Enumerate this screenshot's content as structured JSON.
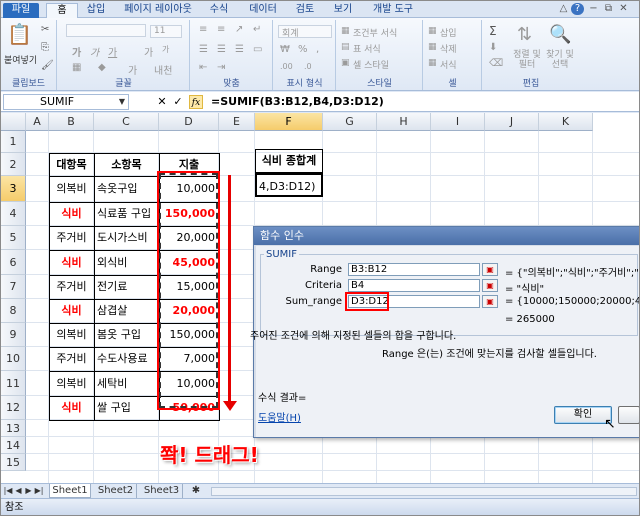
{
  "tabs": {
    "file": "파일",
    "home": "홈",
    "insert": "삽입",
    "page_layout": "페이지 레이아웃",
    "formulas": "수식",
    "data": "데이터",
    "review": "검토",
    "view": "보기",
    "developer": "개발 도구"
  },
  "ribbon": {
    "paste": "붙여넣기",
    "font_size": "11",
    "number_format": "회계",
    "cond_format": "조건부 서식",
    "table_format": "표 서식",
    "cell_style": "셀 스타일",
    "insert": "삽입",
    "delete": "삭제",
    "format": "서식",
    "sort_filter": "정렬 및 필터",
    "find_select": "찾기 및 선택",
    "groups": {
      "clipboard": "클립보드",
      "font": "글꼴",
      "alignment": "맞춤",
      "number": "표시 형식",
      "styles": "스타일",
      "cells": "셀",
      "editing": "편집"
    }
  },
  "formula_bar": {
    "name_box": "SUMIF",
    "formula": "=SUMIF(B3:B12,B4,D3:D12)",
    "cancel": "✕",
    "enter": "✓",
    "fx": "fx"
  },
  "columns": [
    "A",
    "B",
    "C",
    "D",
    "E",
    "F",
    "G",
    "H",
    "I",
    "J",
    "K"
  ],
  "rows": [
    "1",
    "2",
    "3",
    "4",
    "5",
    "6",
    "7",
    "8",
    "9",
    "10",
    "11",
    "12",
    "13",
    "14",
    "15"
  ],
  "table": {
    "headers": [
      "대항목",
      "소항목",
      "지출"
    ],
    "rows": [
      {
        "cat": "의복비",
        "item": "속옷구입",
        "amount": "10,000",
        "hl": false
      },
      {
        "cat": "식비",
        "item": "식료품 구입",
        "amount": "150,000",
        "hl": true
      },
      {
        "cat": "주거비",
        "item": "도시가스비",
        "amount": "20,000",
        "hl": false
      },
      {
        "cat": "식비",
        "item": "외식비",
        "amount": "45,000",
        "hl": true
      },
      {
        "cat": "주거비",
        "item": "전기료",
        "amount": "15,000",
        "hl": false
      },
      {
        "cat": "식비",
        "item": "삼겹살",
        "amount": "20,000",
        "hl": true
      },
      {
        "cat": "의복비",
        "item": "봄옷 구입",
        "amount": "150,000",
        "hl": false
      },
      {
        "cat": "주거비",
        "item": "수도사용료",
        "amount": "7,000",
        "hl": false
      },
      {
        "cat": "의복비",
        "item": "세탁비",
        "amount": "10,000",
        "hl": false
      },
      {
        "cat": "식비",
        "item": "쌀 구입",
        "amount": "50,000",
        "hl": true
      }
    ]
  },
  "summary": {
    "header": "식비 종합계",
    "value": "4,D3:D12)"
  },
  "annotation": "쫙! 드래그!",
  "sheets": [
    "Sheet1",
    "Sheet2",
    "Sheet3"
  ],
  "status": "참조",
  "dialog": {
    "title": "함수 인수",
    "function": "SUMIF",
    "args": [
      {
        "label": "Range",
        "value": "B3:B12",
        "result": "= {\"의복비\";\"식비\";\"주거비\";\"식"
      },
      {
        "label": "Criteria",
        "value": "B4",
        "result": "= \"식비\""
      },
      {
        "label": "Sum_range",
        "value": "D3:D12",
        "result": "= {10000;150000;20000;45000;1"
      }
    ],
    "total": "= 265000",
    "description": "주어진 조건에 의해 지정된 셀들의 합을 구합니다.",
    "arg_help": "Range  은(는) 조건에 맞는지를 검사할 셀들입니다.",
    "result_label": "수식 결과=",
    "help_link": "도움말(H)",
    "ok": "확인"
  },
  "colors": {
    "accent_red": "#ff0000",
    "ribbon_blue": "#dfe8f5",
    "selected_header": "#f5cc6b"
  }
}
